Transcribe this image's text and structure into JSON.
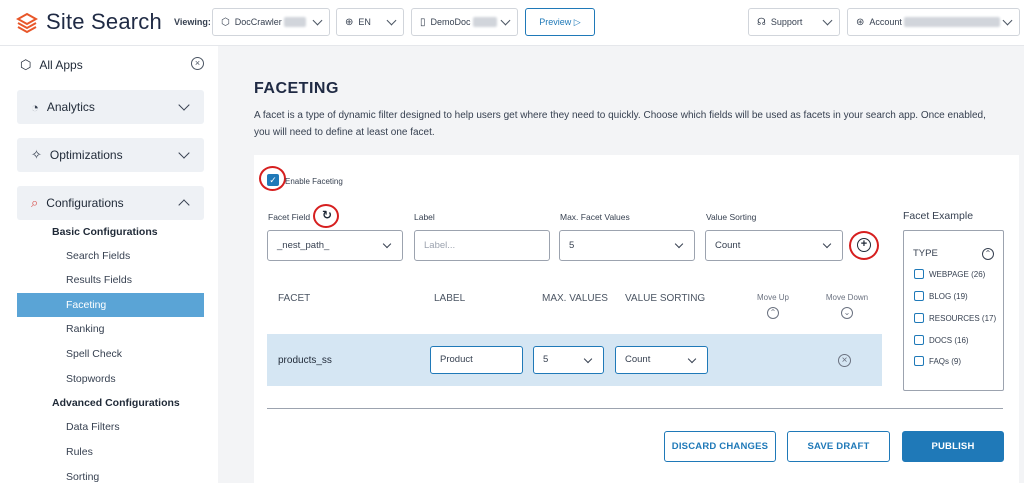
{
  "brand": {
    "name": "Site Search",
    "icon": "layers-icon",
    "color": "#e8572a"
  },
  "topbar": {
    "viewing_label": "Viewing:",
    "app_select": "DocCrawler",
    "lang_select": "EN",
    "engine_select": "DemoDoc",
    "preview_label": "Preview ▷",
    "support_label": "Support",
    "account_label": "Account"
  },
  "sidebar": {
    "all_apps": "All Apps",
    "analytics": "Analytics",
    "optimizations": "Optimizations",
    "configurations": "Configurations",
    "basic_header": "Basic Configurations",
    "basic_items": [
      "Search Fields",
      "Results Fields",
      "Faceting",
      "Ranking",
      "Spell Check",
      "Stopwords"
    ],
    "advanced_header": "Advanced Configurations",
    "advanced_items": [
      "Data Filters",
      "Rules",
      "Sorting"
    ],
    "selected": "Faceting"
  },
  "main": {
    "title": "FACETING",
    "description": "A facet is a type of dynamic filter designed to help users get where they need to quickly. Choose which fields will be used as facets in your search app. Once enabled, you will need to define at least one facet.",
    "enable_label": "Enable Faceting",
    "enabled": true,
    "form": {
      "facet_field_label": "Facet Field",
      "facet_field_value": "_nest_path_",
      "label_label": "Label",
      "label_placeholder": "Label...",
      "max_label": "Max. Facet Values",
      "max_value": "5",
      "sorting_label": "Value Sorting",
      "sorting_value": "Count"
    },
    "table": {
      "headers": {
        "facet": "FACET",
        "label": "LABEL",
        "max": "MAX. VALUES",
        "sorting": "VALUE SORTING",
        "move_up": "Move Up",
        "move_down": "Move Down"
      },
      "rows": [
        {
          "facet": "products_ss",
          "label": "Product",
          "max": "5",
          "sorting": "Count"
        }
      ]
    },
    "example": {
      "title": "Facet Example",
      "type_label": "TYPE",
      "options": [
        "WEBPAGE (26)",
        "BLOG (19)",
        "RESOURCES (17)",
        "DOCS (16)",
        "FAQs (9)"
      ]
    },
    "buttons": {
      "discard": "DISCARD CHANGES",
      "save": "SAVE DRAFT",
      "publish": "PUBLISH"
    }
  },
  "colors": {
    "accent": "#1f79b8",
    "selected_nav": "#5aa4d6",
    "highlight_ring": "#d61f1f",
    "row_bg": "#d5e6f3"
  }
}
